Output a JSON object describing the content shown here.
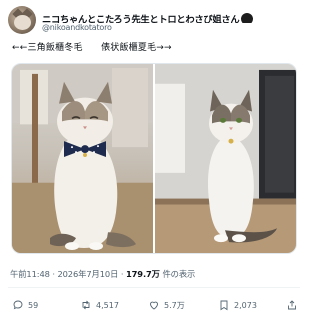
{
  "author": {
    "display_name": "ニコちゃんとこたろう先生とトロとわさび姐さん",
    "badge_icon": "unverified-circle-icon",
    "handle": "@nikoandkotatoro"
  },
  "tweet": {
    "text": "←←三角飯櫃冬毛　　俵状飯櫃夏毛→→"
  },
  "media": {
    "images": [
      {
        "alt": "cat-winter-coat"
      },
      {
        "alt": "cat-summer-coat"
      }
    ]
  },
  "meta": {
    "time": "午前11:48",
    "separator": "·",
    "date": "2026年7月10日",
    "views_count": "179.7万",
    "views_label": "件の表示"
  },
  "actions": {
    "replies": "59",
    "retweets": "4,517",
    "likes": "5.7万",
    "bookmarks": "2,073"
  },
  "colors": {
    "text_primary": "#0f1419",
    "text_secondary": "#536471",
    "divider": "#eff3f4"
  }
}
